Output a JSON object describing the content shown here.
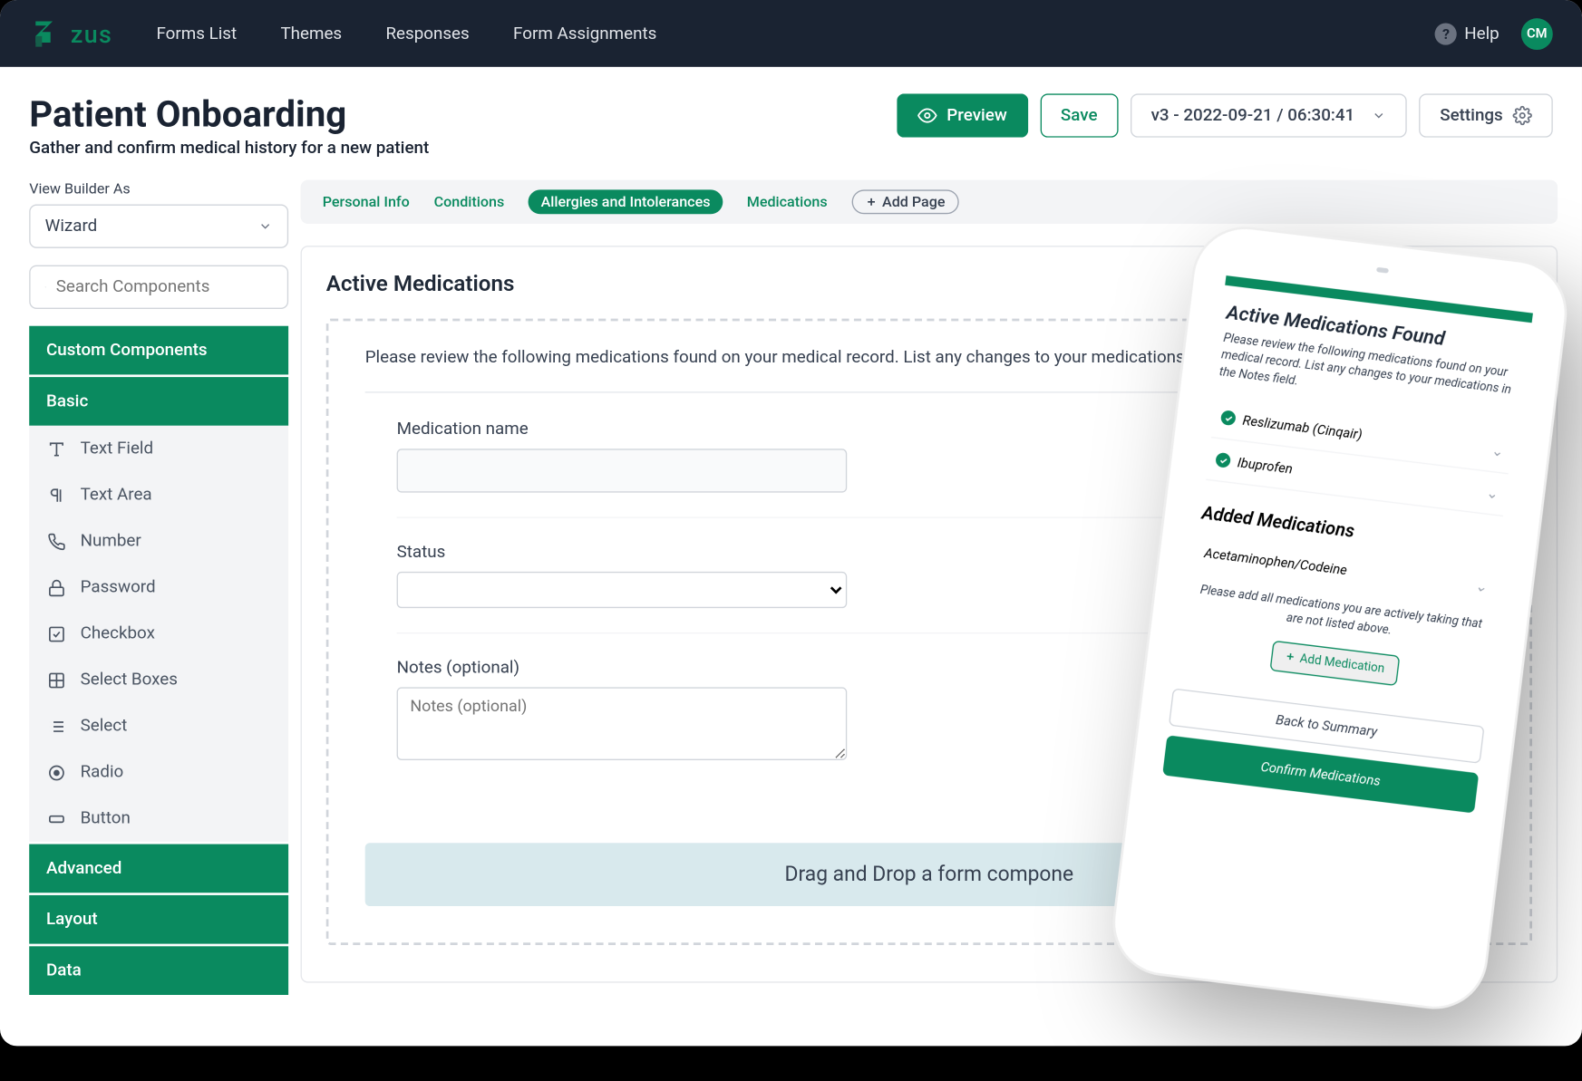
{
  "brand": {
    "name": "zus"
  },
  "nav": {
    "links": [
      "Forms List",
      "Themes",
      "Responses",
      "Form Assignments"
    ],
    "help_label": "Help",
    "avatar_initials": "CM"
  },
  "page": {
    "title": "Patient Onboarding",
    "subtitle": "Gather and confirm medical history for a new patient"
  },
  "header_actions": {
    "preview": "Preview",
    "save": "Save",
    "version": "v3 - 2022-09-21 / 06:30:41",
    "settings": "Settings"
  },
  "sidebar": {
    "view_builder_as_label": "View Builder As",
    "view_builder_as_value": "Wizard",
    "search_placeholder": "Search Components",
    "groups": {
      "custom": "Custom Components",
      "basic": "Basic",
      "advanced": "Advanced",
      "layout": "Layout",
      "data": "Data"
    },
    "basic_items": [
      {
        "label": "Text Field",
        "icon": "text"
      },
      {
        "label": "Text Area",
        "icon": "paragraph"
      },
      {
        "label": "Number",
        "icon": "phone"
      },
      {
        "label": "Password",
        "icon": "lock"
      },
      {
        "label": "Checkbox",
        "icon": "checkbox"
      },
      {
        "label": "Select Boxes",
        "icon": "grid"
      },
      {
        "label": "Select",
        "icon": "list"
      },
      {
        "label": "Radio",
        "icon": "radio"
      },
      {
        "label": "Button",
        "icon": "button"
      }
    ]
  },
  "canvas": {
    "tabs": [
      {
        "label": "Personal Info",
        "active": false
      },
      {
        "label": "Conditions",
        "active": false
      },
      {
        "label": "Allergies and Intolerances",
        "active": true
      },
      {
        "label": "Medications",
        "active": false
      }
    ],
    "add_page_label": "Add Page",
    "section_title": "Active Medications",
    "review_text": "Please review the following medications found on your medical record. List any changes to your medications in the N",
    "form": {
      "medication_label": "Medication name",
      "status_label": "Status",
      "notes_label": "Notes (optional)",
      "notes_placeholder": "Notes (optional)"
    },
    "drop_text": "Drag and Drop a form compone"
  },
  "phone": {
    "title1": "Active Medications Found",
    "desc": "Please review the following medications found on your medical record. List any changes to your medications in the Notes field.",
    "meds": [
      "Reslizumab (Cinqair)",
      "Ibuprofen"
    ],
    "title2": "Added Medications",
    "added": [
      "Acetaminophen/Codeine"
    ],
    "note": "Please add all medications you are actively taking that are not listed above.",
    "add_btn": "Add Medication",
    "back_btn": "Back to Summary",
    "confirm_btn": "Confirm Medications"
  }
}
